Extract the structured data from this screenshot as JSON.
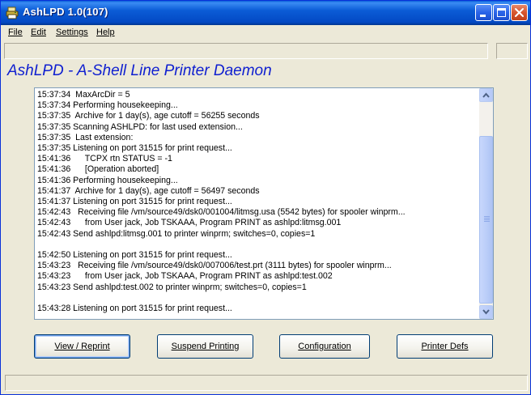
{
  "window": {
    "title": "AshLPD 1.0(107)"
  },
  "menu": [
    {
      "label": "File"
    },
    {
      "label": "Edit"
    },
    {
      "label": "Settings"
    },
    {
      "label": "Help"
    }
  ],
  "banner": "AshLPD - A-Shell Line Printer Daemon",
  "log": {
    "lines": [
      "15:37:34  MaxArcDir = 5",
      "15:37:34 Performing housekeeping...",
      "15:37:35  Archive for 1 day(s), age cutoff = 56255 seconds",
      "15:37:35 Scanning ASHLPD: for last used extension...",
      "15:37:35  Last extension:",
      "15:37:35 Listening on port 31515 for print request...",
      "15:41:36      TCPX rtn STATUS = -1",
      "15:41:36      [Operation aborted]",
      "15:41:36 Performing housekeeping...",
      "15:41:37  Archive for 1 day(s), age cutoff = 56497 seconds",
      "15:41:37 Listening on port 31515 for print request...",
      "15:42:43   Receiving file /vm/source49/dsk0/001004/litmsg.usa (5542 bytes) for spooler winprm...",
      "15:42:43      from User jack, Job TSKAAA, Program PRINT as ashlpd:litmsg.001",
      "15:42:43 Send ashlpd:litmsg.001 to printer winprm; switches=0, copies=1",
      "",
      "15:42:50 Listening on port 31515 for print request...",
      "15:43:23   Receiving file /vm/source49/dsk0/007006/test.prt (3111 bytes) for spooler winprm...",
      "15:43:23      from User jack, Job TSKAAA, Program PRINT as ashlpd:test.002",
      "15:43:23 Send ashlpd:test.002 to printer winprm; switches=0, copies=1",
      "",
      "15:43:28 Listening on port 31515 for print request..."
    ]
  },
  "buttons": {
    "view": "View / Reprint",
    "suspend": "Suspend Printing",
    "config": "Configuration",
    "printer_defs": "Printer Defs"
  },
  "icons": {
    "app": "printer-app-icon",
    "minimize": "minimize-icon",
    "maximize": "maximize-icon",
    "close": "close-icon"
  },
  "colors": {
    "titlebar": "#0b5cd6",
    "banner_text": "#1020d0",
    "face": "#ece9d8"
  }
}
